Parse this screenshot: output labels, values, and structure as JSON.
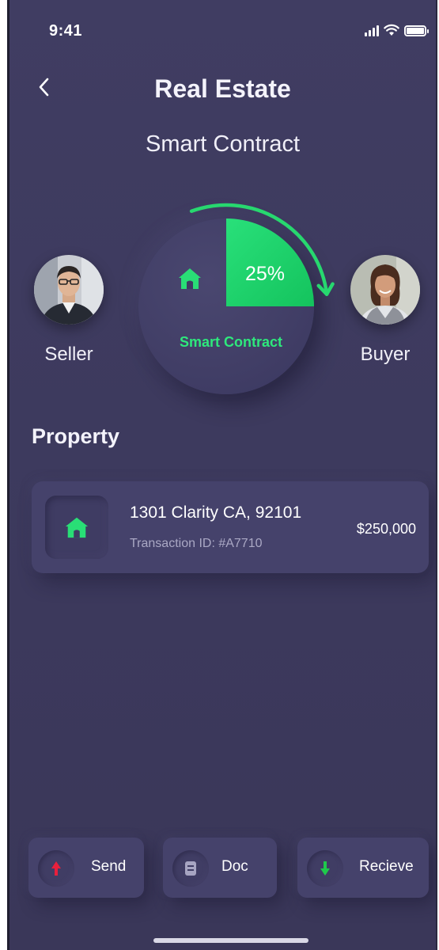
{
  "status_bar": {
    "time": "9:41"
  },
  "header": {
    "title": "Real Estate",
    "subtitle": "Smart Contract"
  },
  "parties": {
    "seller": {
      "label": "Seller"
    },
    "buyer": {
      "label": "Buyer"
    }
  },
  "contract": {
    "progress_percent": 25,
    "progress_label": "25%",
    "label": "Smart Contract"
  },
  "property_section": {
    "title": "Property",
    "address": "1301 Clarity CA, 92101",
    "transaction": "Transaction ID: #A7710",
    "price": "$250,000"
  },
  "actions": {
    "send": "Send",
    "doc": "Doc",
    "receive": "Recieve"
  },
  "colors": {
    "background": "#3f3c62",
    "accent_green": "#2ee87c",
    "send_red": "#e8203c",
    "receive_green": "#1fc94b"
  },
  "icons": {
    "back": "chevron-left-icon",
    "house": "house-icon",
    "send": "arrow-up-icon",
    "doc": "document-icon",
    "receive": "arrow-down-icon"
  }
}
